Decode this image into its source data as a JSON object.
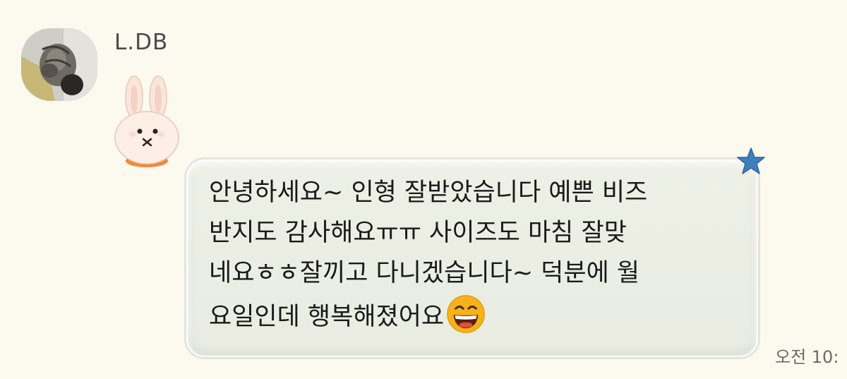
{
  "message": {
    "sender": "L.DB",
    "lines": [
      "안녕하세요~ 인형 잘받았습니다 예쁜 비즈",
      "반지도 감사해요ㅠㅠ 사이즈도 마침 잘맞",
      "네요ㅎㅎ잘끼고 다니겠습니다~ 덕분에 월",
      "요일인데 행복해졌어요"
    ],
    "timestamp": "오전 10:"
  },
  "icons": {
    "avatar": "cat-photo-avatar",
    "sticker": "white-bunny-sticker",
    "emoji": "grinning-squinting-face-emoji",
    "decoration": "blue-star-icon"
  },
  "colors": {
    "background": "#fcf9ef",
    "bubble": "#eef0e6",
    "star": "#3f7fbf",
    "emoji": "#f6b21a"
  }
}
